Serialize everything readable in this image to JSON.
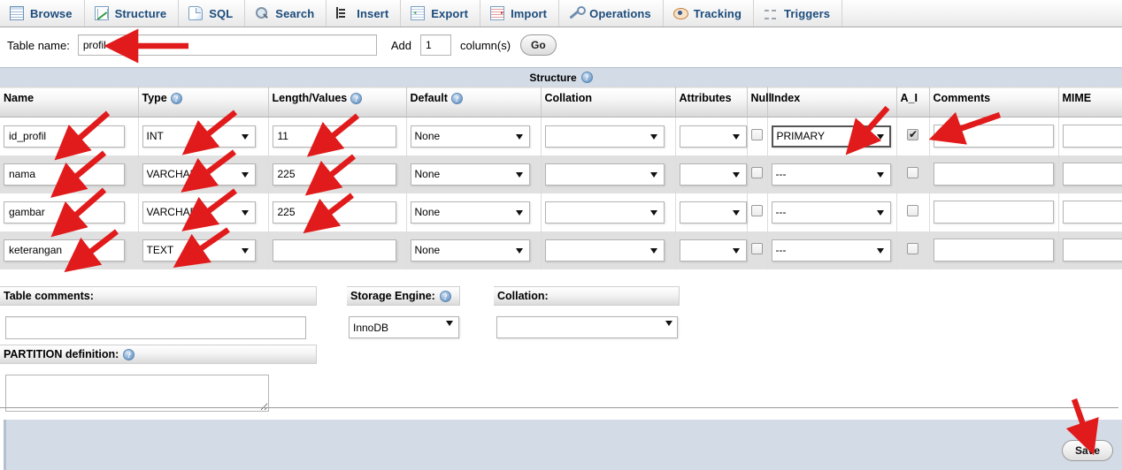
{
  "tabs": [
    {
      "label": "Browse",
      "icon": "browse-icon"
    },
    {
      "label": "Structure",
      "icon": "structure-icon"
    },
    {
      "label": "SQL",
      "icon": "sql-icon"
    },
    {
      "label": "Search",
      "icon": "search-icon"
    },
    {
      "label": "Insert",
      "icon": "insert-icon"
    },
    {
      "label": "Export",
      "icon": "export-icon"
    },
    {
      "label": "Import",
      "icon": "import-icon"
    },
    {
      "label": "Operations",
      "icon": "wrench-icon"
    },
    {
      "label": "Tracking",
      "icon": "eye-icon"
    },
    {
      "label": "Triggers",
      "icon": "triggers-icon"
    }
  ],
  "form_header": {
    "table_name_label": "Table name:",
    "table_name_value": "profil",
    "add_label": "Add",
    "add_columns_value": "1",
    "columns_label": "column(s)",
    "go_label": "Go"
  },
  "structure": {
    "title": "Structure",
    "help_glyph": "?",
    "headers": [
      {
        "label": "Name",
        "help": false
      },
      {
        "label": "Type",
        "help": true
      },
      {
        "label": "Length/Values",
        "help": true
      },
      {
        "label": "Default",
        "help": true
      },
      {
        "label": "Collation",
        "help": false
      },
      {
        "label": "Attributes",
        "help": false
      },
      {
        "label": "Null",
        "help": false
      },
      {
        "label": "Index",
        "help": false
      },
      {
        "label": "A_I",
        "help": false
      },
      {
        "label": "Comments",
        "help": false
      },
      {
        "label": "MIME",
        "help": false
      }
    ],
    "rows": [
      {
        "name": "id_profil",
        "type": "INT",
        "length": "11",
        "default": "None",
        "collation": "",
        "attributes": "",
        "null": false,
        "index": "PRIMARY",
        "index_focused": true,
        "auto_increment": true,
        "comments": "",
        "mime": ""
      },
      {
        "name": "nama",
        "type": "VARCHAR",
        "length": "225",
        "default": "None",
        "collation": "",
        "attributes": "",
        "null": false,
        "index": "---",
        "index_focused": false,
        "auto_increment": false,
        "comments": "",
        "mime": ""
      },
      {
        "name": "gambar",
        "type": "VARCHAR",
        "length": "225",
        "default": "None",
        "collation": "",
        "attributes": "",
        "null": false,
        "index": "---",
        "index_focused": false,
        "auto_increment": false,
        "comments": "",
        "mime": ""
      },
      {
        "name": "keterangan",
        "type": "TEXT",
        "length": "",
        "default": "None",
        "collation": "",
        "attributes": "",
        "null": false,
        "index": "---",
        "index_focused": false,
        "auto_increment": false,
        "comments": "",
        "mime": ""
      }
    ]
  },
  "bottom": {
    "table_comments_label": "Table comments:",
    "table_comments_value": "",
    "partition_label": "PARTITION definition:",
    "partition_value": "",
    "storage_engine_label": "Storage Engine:",
    "storage_engine_value": "InnoDB",
    "collation_label": "Collation:",
    "collation_value": ""
  },
  "footer": {
    "save_label": "Save"
  },
  "colors": {
    "tab_text": "#1c4c7c",
    "panel_header": "#d3dce6",
    "row_alt": "#e0e0e0",
    "annotation_arrow": "#e11b1b",
    "footer_bg": "#d3dce6"
  },
  "annotations": {
    "arrow_color": "#e11b1b",
    "count": 12,
    "targets": [
      "table-name-input",
      "row1-name-input",
      "row1-type-select",
      "row1-length-input",
      "row1-index-select",
      "row1-ai-checkbox",
      "row2-name-input",
      "row2-type-select",
      "row2-length-input",
      "row3-name-input",
      "row3-type-select",
      "row3-length-input",
      "row4-name-input",
      "row4-type-select",
      "save-button"
    ]
  }
}
